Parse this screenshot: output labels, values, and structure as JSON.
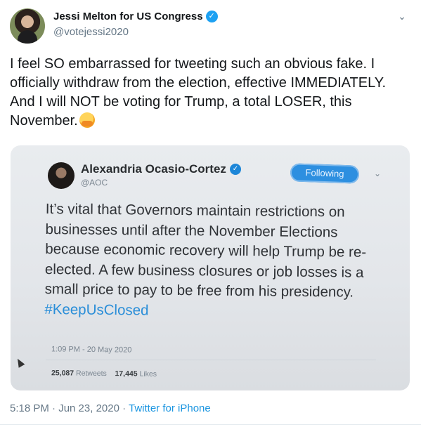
{
  "author": {
    "name": "Jessi Melton for US Congress",
    "handle": "@votejessi2020"
  },
  "tweet": {
    "text": "I feel SO embarrassed for tweeting such an obvious fake. I officially withdraw from the election, effective IMMEDIATELY. And I will NOT be voting for Trump, a total LOSER, this November."
  },
  "media": {
    "name": "Alexandria Ocasio-Cortez",
    "handle": "@AOC",
    "follow_label": "Following",
    "body": "It’s vital that Governors maintain restrictions on businesses until after the November Elections because economic recovery will help Trump be re-elected. A few business closures or job losses is a small price to pay to be free from his presidency.",
    "hashtag": "#KeepUsClosed",
    "timestamp": "1:09 PM - 20 May 2020",
    "retweets_count": "25,087",
    "retweets_label": "Retweets",
    "likes_count": "17,445",
    "likes_label": "Likes"
  },
  "footer": {
    "time": "5:18 PM · Jun 23, 2020 · ",
    "source": "Twitter for iPhone"
  },
  "icons": {
    "verified": "verified-badge-icon",
    "chevron": "chevron-down-icon",
    "emoji": "hugging-face-emoji"
  },
  "colors": {
    "link": "#1b95e0",
    "verified": "#1da1f2",
    "muted": "#657786"
  }
}
